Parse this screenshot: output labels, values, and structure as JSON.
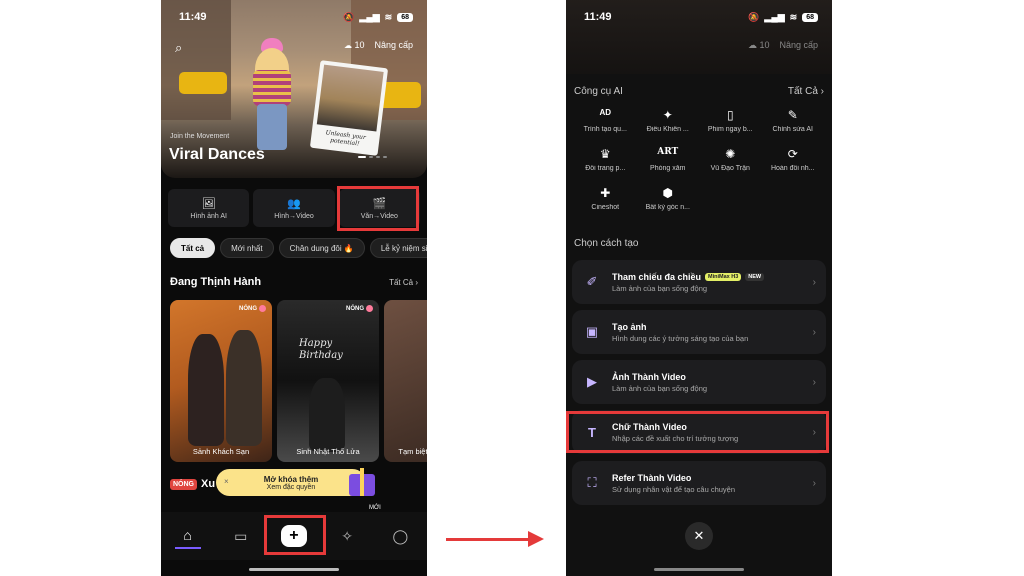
{
  "left": {
    "status": {
      "time": "11:49",
      "battery": "68"
    },
    "credits": {
      "count": "10",
      "upgrade": "Nâng cấp"
    },
    "hero": {
      "subtitle": "Join the Movement",
      "title": "Viral Dances",
      "polaroid_caption": "Unleash your potential!"
    },
    "tools": [
      {
        "label": "Hình ảnh AI",
        "icon": "🖼"
      },
      {
        "label": "Hình→Video",
        "icon": "👥"
      },
      {
        "label": "Văn→Video",
        "icon": "🎬"
      }
    ],
    "filters": [
      "Tất cả",
      "Mới nhất",
      "Chân dung đôi 🔥",
      "Lễ kỷ niệm si"
    ],
    "trending": {
      "title": "Đang Thịnh Hành",
      "see_all": "Tất Cả ›"
    },
    "cards": [
      {
        "label": "Sảnh Khách Sạn",
        "hot": "NÓNG"
      },
      {
        "label": "Sinh Nhật Thổ Lửa",
        "hot": "NÓNG"
      },
      {
        "label": "Tạm biệt,"
      }
    ],
    "birthday_text": "Happy Birthday",
    "unlock": {
      "line1": "Mở khóa thêm",
      "line2": "Xem đặc quyền",
      "close": "×"
    },
    "hot_section": {
      "tag": "NÓNG",
      "title": "Xu h"
    },
    "card_badge_small": "MỚI"
  },
  "right": {
    "status": {
      "time": "11:49",
      "battery": "68"
    },
    "credits": {
      "count": "10",
      "upgrade": "Nâng cấp"
    },
    "ai_tools": {
      "title": "Công cụ AI",
      "see_all": "Tất Cả ›",
      "items": [
        {
          "label": "Trình tạo qu...",
          "icon": "AD"
        },
        {
          "label": "Điều Khiển ...",
          "icon": "✦"
        },
        {
          "label": "Phim ngay b...",
          "icon": "▯"
        },
        {
          "label": "Chỉnh sửa AI",
          "icon": "✎"
        },
        {
          "label": "Đổi trang p...",
          "icon": "♛"
        },
        {
          "label": "Phòng xăm",
          "icon": "ART"
        },
        {
          "label": "Vũ Đạo Trận",
          "icon": "✺"
        },
        {
          "label": "Hoán đổi nh...",
          "icon": "⟳"
        },
        {
          "label": "Cineshot",
          "icon": "✚"
        },
        {
          "label": "Bất kỳ góc n...",
          "icon": "⬢"
        }
      ]
    },
    "create": {
      "title": "Chọn cách tạo",
      "options": [
        {
          "title": "Tham chiếu đa chiều",
          "sub": "Làm ảnh của bạn sống động",
          "icon": "✐",
          "badge1": "MiniMax H3",
          "badge2": "NEW"
        },
        {
          "title": "Tạo ảnh",
          "sub": "Hình dung các ý tưởng sáng tạo của bạn",
          "icon": "▣"
        },
        {
          "title": "Ảnh Thành Video",
          "sub": "Làm ảnh của bạn sống động",
          "icon": "▶"
        },
        {
          "title": "Chữ Thành Video",
          "sub": "Nhập các đề xuất cho trí tưởng tượng",
          "icon": "T"
        },
        {
          "title": "Refer Thành Video",
          "sub": "Sử dụng nhân vật để tạo câu chuyện",
          "icon": "⛶"
        }
      ]
    },
    "close": "✕"
  }
}
